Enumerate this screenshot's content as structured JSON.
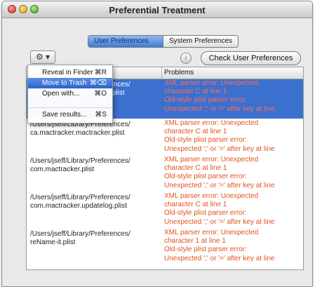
{
  "window": {
    "title": "Preferential Treatment"
  },
  "segmented": {
    "options": [
      "User Preferences",
      "System Preferences"
    ],
    "selected": 0
  },
  "toolbar": {
    "gear_glyph": "⚙ ▾",
    "info_glyph": "i",
    "check_button_label": "Check User Preferences"
  },
  "table": {
    "columns": [
      "",
      "Problems"
    ],
    "rows": [
      {
        "selected": true,
        "path": [
          "/Users/jseff/Library/Preferences/",
          "ca.mactracker.mactracker.plist"
        ],
        "problems": [
          "XML parser error: Unexpected",
          "character C at line 1",
          "Old-style plist parser error:",
          "Unexpected ';' or '=' after key at line"
        ]
      },
      {
        "selected": false,
        "path": [
          "/Users/jseff/Library/Preferences/",
          "ca.mactracker.mactracker.plist"
        ],
        "problems": [
          "XML parser error: Unexpected",
          "character C at line 1",
          "Old-style plist parser error:",
          "Unexpected ';' or '=' after key at line"
        ]
      },
      {
        "selected": false,
        "path": [
          "/Users/jseff/Library/Preferences/",
          "com.mactracker.plist"
        ],
        "problems": [
          "XML parser error: Unexpected",
          "character C at line 1",
          "Old-style plist parser error:",
          "Unexpected ';' or '=' after key at line"
        ]
      },
      {
        "selected": false,
        "path": [
          "/Users/jseff/Library/Preferences/",
          "com.mactracker.updatelog.plist"
        ],
        "problems": [
          "XML parser error: Unexpected",
          "character C at line 1",
          "Old-style plist parser error:",
          "Unexpected ';' or '=' after key at line"
        ]
      },
      {
        "selected": false,
        "path": [
          "/Users/jseff/Library/Preferences/",
          "reName-it.plist"
        ],
        "problems": [
          "XML parser error: Unexpected",
          "character 1 at line 1",
          "Old-style plist parser error:",
          "Unexpected ';' or '=' after key at line"
        ]
      }
    ]
  },
  "context_menu": {
    "items": [
      {
        "label": "Reveal in Finder",
        "shortcut": "⌘R"
      },
      {
        "label": "Move to Trash",
        "shortcut": "⌘⌫"
      },
      {
        "label": "Open with...",
        "shortcut": "⌘O"
      },
      {
        "label": "Save results...",
        "shortcut": "⌘S"
      }
    ],
    "highlighted": 1
  },
  "colors": {
    "selection": "#3b70cf",
    "problem_text": "#e2521c"
  }
}
